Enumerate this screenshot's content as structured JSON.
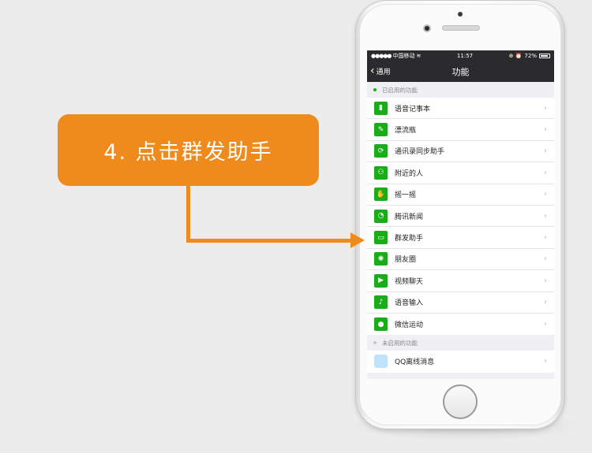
{
  "callout": {
    "text": "4. 点击群发助手"
  },
  "status_bar": {
    "signal": "●●●●●",
    "carrier": "中国移动",
    "wifi": "≋",
    "time": "11:57",
    "battery_pct": "72%",
    "icons": "⊕ ⏰"
  },
  "nav": {
    "back_label": "通用",
    "title": "功能"
  },
  "colors": {
    "accent": "#ef8a1c",
    "wechat_green": "#1aad19",
    "nav_bg": "#2b2b2d"
  },
  "enabled_section": {
    "header": "已启用的功能",
    "items": [
      {
        "label": "语音记事本",
        "icon": "notebook-icon",
        "glyph": "▮"
      },
      {
        "label": "漂流瓶",
        "icon": "bottle-icon",
        "glyph": "✎"
      },
      {
        "label": "通讯录同步助手",
        "icon": "sync-icon",
        "glyph": "⟳"
      },
      {
        "label": "附近的人",
        "icon": "people-icon",
        "glyph": "⚇"
      },
      {
        "label": "摇一摇",
        "icon": "shake-icon",
        "glyph": "✋"
      },
      {
        "label": "腾讯新闻",
        "icon": "news-icon",
        "glyph": "◔"
      },
      {
        "label": "群发助手",
        "icon": "broadcast-icon",
        "glyph": "▭"
      },
      {
        "label": "朋友圈",
        "icon": "moments-icon",
        "glyph": "✺"
      },
      {
        "label": "视频聊天",
        "icon": "video-icon",
        "glyph": "▶"
      },
      {
        "label": "语音输入",
        "icon": "mic-icon",
        "glyph": "♪"
      },
      {
        "label": "微信运动",
        "icon": "sport-icon",
        "glyph": "●"
      }
    ]
  },
  "disabled_section": {
    "header": "未启用的功能",
    "items": [
      {
        "label": "QQ离线消息",
        "icon": "qq-icon"
      }
    ]
  }
}
